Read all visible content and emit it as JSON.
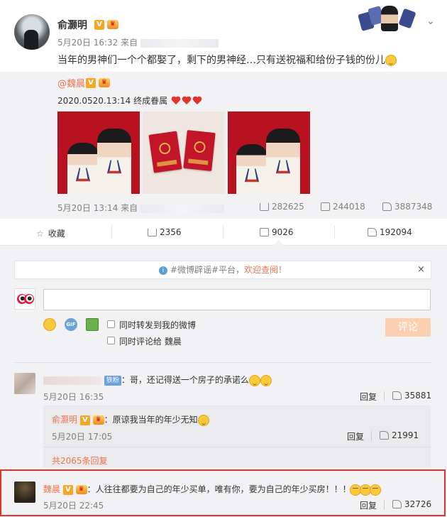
{
  "post": {
    "username": "俞灏明",
    "v_badge": "V",
    "time": "5月20日 16:32 来自",
    "text": "当年的男神们一个个都娶了，剩下的男神经…只有送祝福和给份子钱的份儿"
  },
  "repost": {
    "username": "@魏晨",
    "text": "2020.0520.13:14 终成眷属",
    "time": "5月20日 13:14 来自",
    "forwards": "282625",
    "comments": "244018",
    "likes": "3887348"
  },
  "actions": {
    "favorite": "收藏",
    "forward": "2356",
    "comment": "9026",
    "like": "192094"
  },
  "notice": {
    "prefix": "#微博辟谣#平台，",
    "link": "欢迎查阅！",
    "close": "×"
  },
  "composer": {
    "placeholder": "",
    "gif": "GIF",
    "sync_forward": "同时转发到我的微博",
    "sync_comment": "同时评论给 魏晨",
    "submit": "评论"
  },
  "comments": [
    {
      "badge": "铁粉",
      "text": "：哥，还记得送一个房子的承诺么",
      "time": "5月20日 16:35",
      "reply": "回复",
      "likes": "35881",
      "sub_reply": {
        "username": "俞灏明",
        "text": "：原谅我当年的年少无知",
        "time": "5月20日 17:05",
        "reply": "回复",
        "likes": "21991"
      },
      "more": "共2065条回复"
    },
    {
      "username": "魏晨",
      "text": "：人往往都要为自己的年少买单，唯有你，要为自己的年少买房！！！",
      "time": "5月20日 22:45",
      "reply": "回复",
      "likes": "32726"
    }
  ],
  "icons": {
    "more": "chevron-down-icon",
    "forward": "forward-icon",
    "comment": "comment-icon",
    "like": "thumb-up-icon",
    "info": "info-icon"
  },
  "colors": {
    "link_orange": "#eb7350",
    "highlight_red": "#e1342e",
    "vip_gold": "#f5a623"
  }
}
